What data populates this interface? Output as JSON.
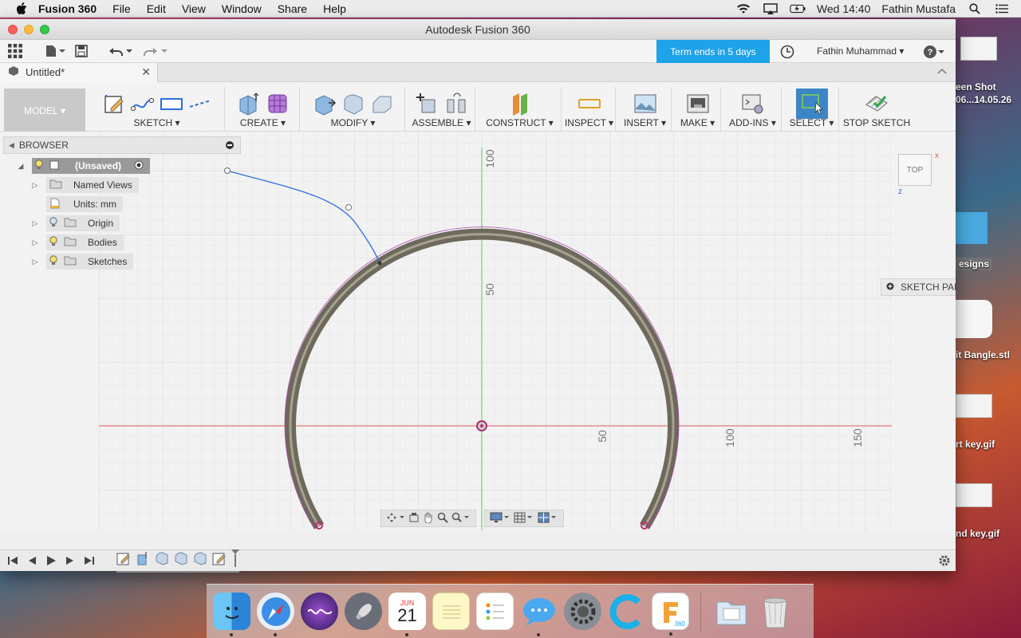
{
  "menubar": {
    "app": "Fusion 360",
    "items": [
      "File",
      "Edit",
      "View",
      "Window",
      "Share",
      "Help"
    ],
    "clock": "Wed 14:40",
    "user": "Fathin Mustafa"
  },
  "window": {
    "title": "Autodesk Fusion 360"
  },
  "qat": {
    "term_notice": "Term ends in 5 days",
    "user": "Fathin Muhammad"
  },
  "doc_tab": {
    "name": "Untitled*"
  },
  "toolbar": {
    "workspace": "MODEL",
    "groups": [
      "SKETCH",
      "CREATE",
      "MODIFY",
      "ASSEMBLE",
      "CONSTRUCT",
      "INSPECT",
      "INSERT",
      "MAKE",
      "ADD-INS",
      "SELECT",
      "STOP SKETCH"
    ]
  },
  "browser": {
    "title": "BROWSER",
    "root": "(Unsaved)",
    "nodes": [
      "Named Views",
      "Units: mm",
      "Origin",
      "Bodies",
      "Sketches"
    ]
  },
  "viewcube": {
    "face": "TOP"
  },
  "palette": {
    "title": "SKETCH PALETTE"
  },
  "axis_labels": {
    "v100": "100",
    "v50": "50",
    "h50": "50",
    "h100": "100",
    "h150": "150"
  },
  "desktop": {
    "items": [
      "een Shot",
      "06...14.05.26",
      "esigns",
      "it Bangle.stl",
      "rt key.gif",
      "nd key.gif"
    ]
  },
  "dock": {
    "calendar_month": "JUN",
    "calendar_day": "21",
    "fusion_badge": "360"
  },
  "colors": {
    "accent": "#1ea2e8",
    "sketch_blue": "#2d6fe0",
    "axis_red": "#e05a5a",
    "axis_green": "#5cc85c"
  }
}
